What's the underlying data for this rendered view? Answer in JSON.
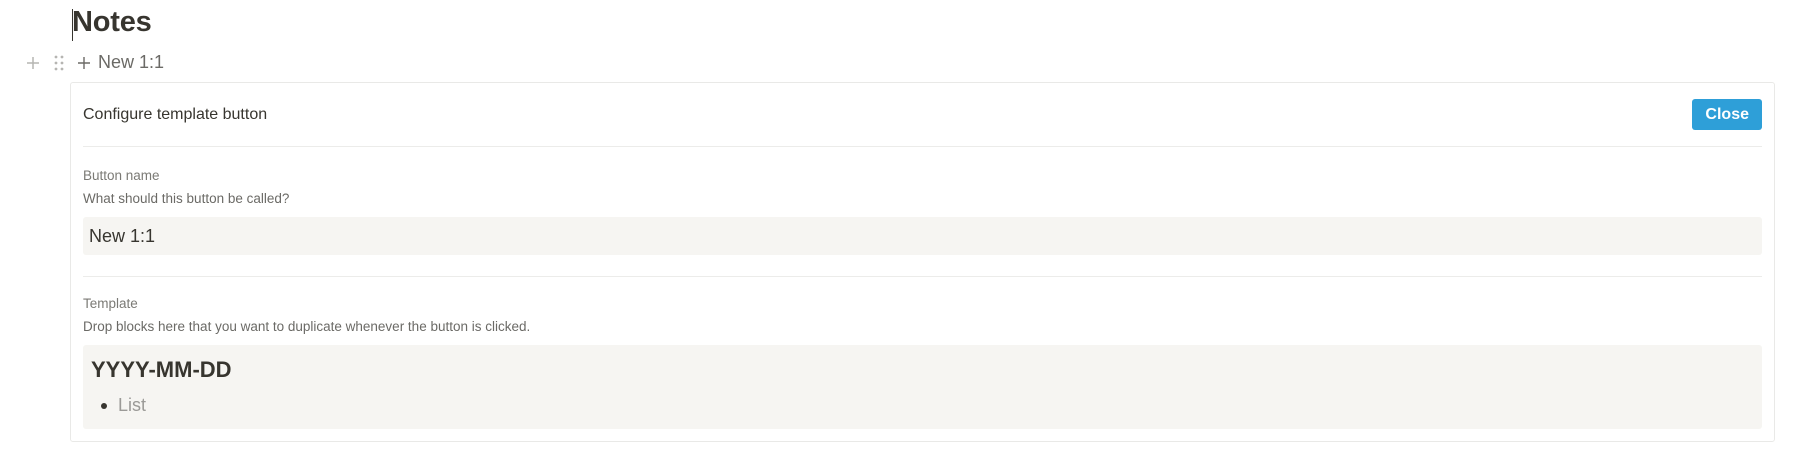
{
  "page": {
    "title": "Notes"
  },
  "block_controls": {
    "add_icon": "plus-icon",
    "drag_icon": "drag-handle-icon"
  },
  "template_button": {
    "icon": "plus-icon",
    "label": "New 1:1"
  },
  "config_panel": {
    "title": "Configure template button",
    "close_label": "Close",
    "close_color": "#2e9fd8",
    "button_name": {
      "label": "Button name",
      "hint": "What should this button be called?",
      "value": "New 1:1"
    },
    "template": {
      "label": "Template",
      "hint": "Drop blocks here that you want to duplicate whenever the button is clicked.",
      "heading": "YYYY-MM-DD",
      "list_placeholder": "List"
    }
  }
}
